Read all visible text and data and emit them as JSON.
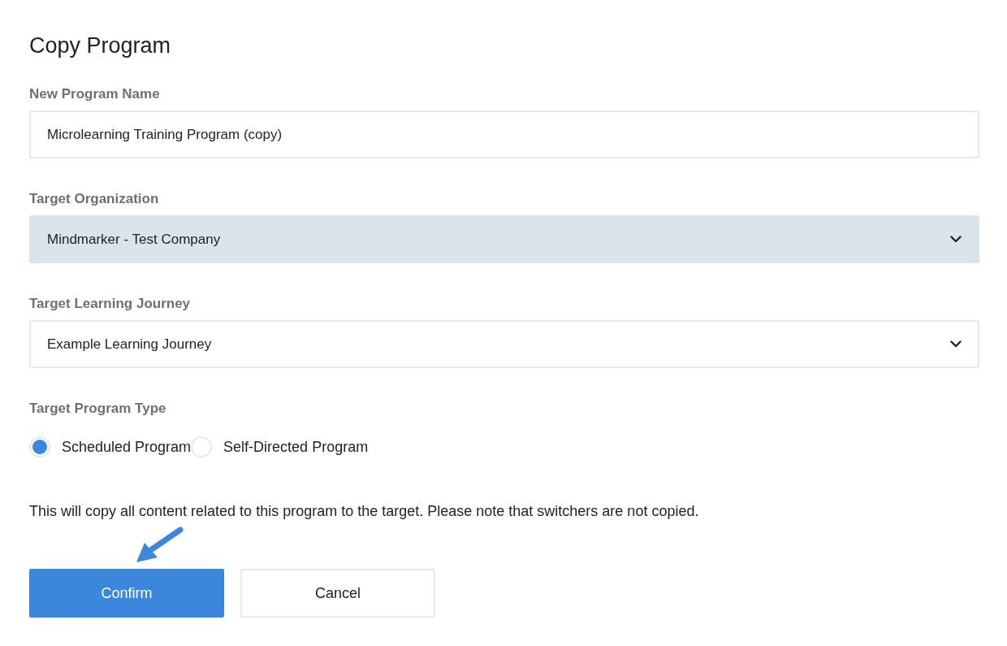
{
  "title": "Copy Program",
  "fields": [
    {
      "kind": "text",
      "label": "New Program Name",
      "value": "Microlearning Training Program (copy)"
    },
    {
      "kind": "select",
      "label": "Target Organization",
      "value": "Mindmarker - Test Company",
      "highlighted": true
    },
    {
      "kind": "select",
      "label": "Target Learning Journey",
      "value": "Example Learning Journey",
      "highlighted": false
    }
  ],
  "program_type": {
    "label": "Target Program Type",
    "options": [
      {
        "label": "Scheduled Program",
        "selected": true
      },
      {
        "label": "Self-Directed Program",
        "selected": false
      }
    ]
  },
  "note": "This will copy all content related to this program to the target. Please note that switchers are not copied.",
  "buttons": [
    {
      "kind": "primary",
      "label": "Confirm"
    },
    {
      "kind": "secondary",
      "label": "Cancel"
    }
  ]
}
